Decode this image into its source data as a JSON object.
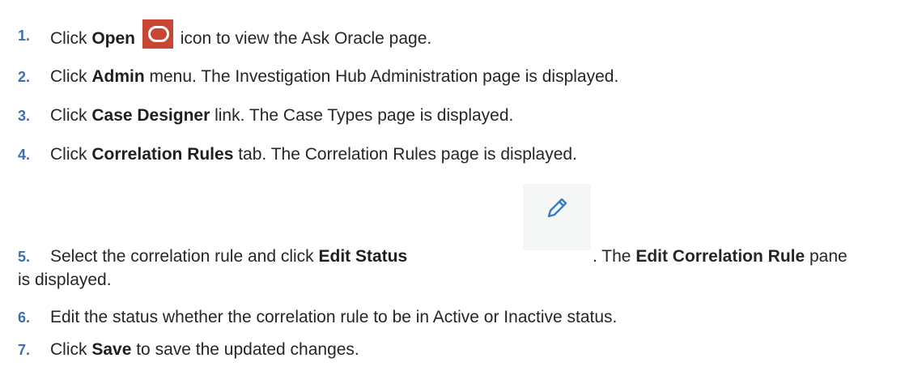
{
  "steps": [
    {
      "num": "1.",
      "pre": "Click ",
      "bold": "Open",
      "icon": "open-icon",
      "post": " icon to view the Ask Oracle page."
    },
    {
      "num": "2.",
      "pre": "Click ",
      "bold": "Admin",
      "post": " menu. The Investigation Hub Administration page is displayed."
    },
    {
      "num": "3.",
      "pre": "Click ",
      "bold": "Case Designer",
      "post": " link. The Case Types page is displayed."
    },
    {
      "num": "4.",
      "pre": "Click ",
      "bold": "Correlation Rules",
      "post": " tab. The Correlation Rules page is displayed."
    },
    {
      "num": "5.",
      "pre": "Select the correlation rule and click ",
      "bold": "Edit Status",
      "icon": "pencil-edit-icon",
      "mid": ". The ",
      "bold2": "Edit Correlation Rule",
      "post": " pane",
      "wrap": "is displayed."
    },
    {
      "num": "6.",
      "pre": "Edit the status whether the correlation rule to be in Active or Inactive status."
    },
    {
      "num": "7.",
      "pre": "Click ",
      "bold": "Save",
      "post": " to save the updated changes."
    }
  ],
  "colors": {
    "step_number": "#3b6fae",
    "open_icon_bg": "#c74634",
    "edit_icon_bg": "#f5f6f6",
    "pencil": "#3a7bbf"
  }
}
